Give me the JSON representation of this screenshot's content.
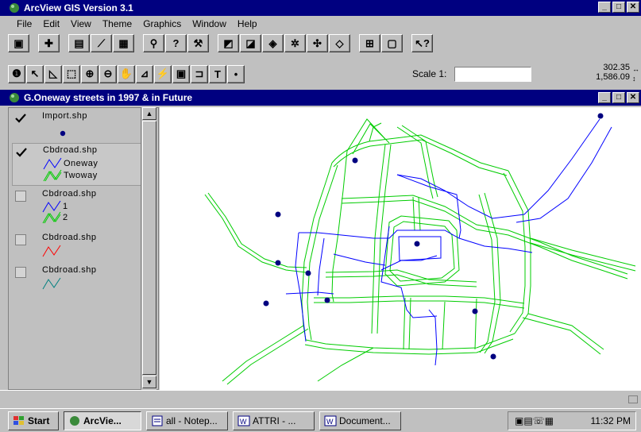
{
  "app": {
    "title": "ArcView GIS Version 3.1",
    "window_buttons": [
      "_",
      "□",
      "✕"
    ]
  },
  "menubar": {
    "items": [
      "File",
      "Edit",
      "View",
      "Theme",
      "Graphics",
      "Window",
      "Help"
    ]
  },
  "toolbar": {
    "scale_label": "Scale 1:",
    "scale_value": "",
    "coord_x": "302.35",
    "coord_y": "1,586.09"
  },
  "view": {
    "title": "G.Oneway streets in 1997 & in Future"
  },
  "toc": {
    "themes": [
      {
        "name": "Import.shp",
        "checked": true,
        "legend": [
          {
            "label": "",
            "symbol": "point",
            "color": "#000080"
          }
        ]
      },
      {
        "name": "Cbdroad.shp",
        "checked": true,
        "legend": [
          {
            "label": "Oneway",
            "symbol": "line",
            "color": "#0000ff"
          },
          {
            "label": "Twoway",
            "symbol": "double-line",
            "color": "#00cc00"
          }
        ]
      },
      {
        "name": "Cbdroad.shp",
        "checked": false,
        "legend": [
          {
            "label": "1",
            "symbol": "line",
            "color": "#0000ff"
          },
          {
            "label": "2",
            "symbol": "double-line",
            "color": "#00cc00"
          }
        ]
      },
      {
        "name": "Cbdroad.shp",
        "checked": false,
        "legend": [
          {
            "label": "",
            "symbol": "line",
            "color": "#ff0000"
          }
        ]
      },
      {
        "name": "Cbdroad.shp",
        "checked": false,
        "legend": [
          {
            "label": "",
            "symbol": "line",
            "color": "#008080"
          }
        ]
      }
    ]
  },
  "taskbar": {
    "start": "Start",
    "tasks": [
      "ArcVie...",
      "all - Notep...",
      "ATTRI - ...",
      "Document..."
    ],
    "clock": "11:32 PM"
  },
  "colors": {
    "title_bg": "#000080",
    "oneway": "#0000ff",
    "twoway": "#00cc00",
    "points": "#000080"
  }
}
